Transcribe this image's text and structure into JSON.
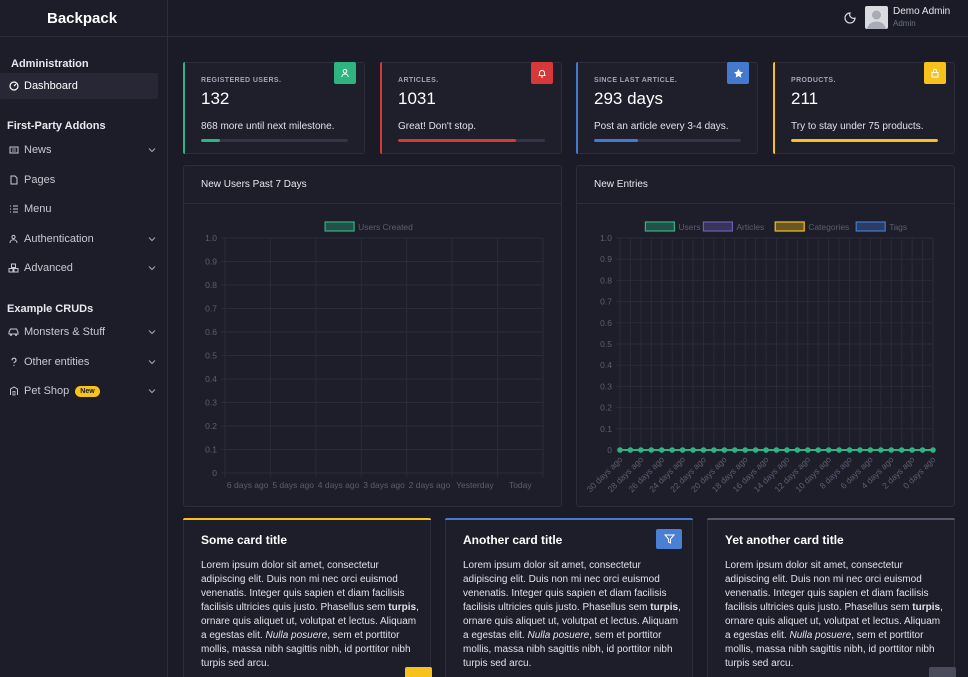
{
  "app": {
    "brand": "Backpack"
  },
  "user": {
    "name": "Demo Admin",
    "role": "Admin"
  },
  "sidebar": {
    "sections": [
      {
        "heading": "Administration",
        "items": [
          {
            "label": "Dashboard",
            "icon": "dashboard-icon",
            "active": true
          }
        ]
      },
      {
        "heading": "First-Party Addons",
        "items": [
          {
            "label": "News",
            "icon": "newspaper-icon",
            "expandable": true
          },
          {
            "label": "Pages",
            "icon": "file-icon"
          },
          {
            "label": "Menu",
            "icon": "list-icon"
          },
          {
            "label": "Authentication",
            "icon": "users-group-icon",
            "expandable": true
          },
          {
            "label": "Advanced",
            "icon": "cubes-icon",
            "expandable": true
          }
        ]
      },
      {
        "heading": "Example CRUDs",
        "items": [
          {
            "label": "Monsters & Stuff",
            "icon": "car-icon",
            "expandable": true
          },
          {
            "label": "Other entities",
            "icon": "question-icon",
            "expandable": true
          },
          {
            "label": "Pet Shop",
            "icon": "paw-icon",
            "expandable": true,
            "badge": "New"
          }
        ]
      }
    ]
  },
  "stats": [
    {
      "label": "REGISTERED USERS.",
      "value": "132",
      "description": "868 more until next milestone.",
      "progress": 0.13,
      "color": "#2fb380",
      "icon": "user-icon"
    },
    {
      "label": "ARTICLES.",
      "value": "1031",
      "description": "Great! Don't stop.",
      "progress": 0.8,
      "color": "#d63939",
      "icon": "bell-icon"
    },
    {
      "label": "SINCE LAST ARTICLE.",
      "value": "293 days",
      "description": "Post an article every 3-4 days.",
      "progress": 0.3,
      "color": "#4479d0",
      "icon": "star-icon"
    },
    {
      "label": "PRODUCTS.",
      "value": "211",
      "description": "Try to stay under 75 products.",
      "progress": 1.0,
      "color": "#f7c21b",
      "icon": "lock-icon"
    }
  ],
  "charts": {
    "users": {
      "title": "New Users Past 7 Days"
    },
    "entries": {
      "title": "New Entries"
    }
  },
  "chart_data": [
    {
      "type": "bar",
      "title": "New Users Past 7 Days",
      "categories": [
        "6 days ago",
        "5 days ago",
        "4 days ago",
        "3 days ago",
        "2 days ago",
        "Yesterday",
        "Today"
      ],
      "series": [
        {
          "name": "Users Created",
          "values": [
            0,
            0,
            0,
            0,
            0,
            0,
            0
          ],
          "color": "#2fb380"
        }
      ],
      "ylim": [
        0,
        1.0
      ],
      "yticks": [
        "0",
        "0.1",
        "0.2",
        "0.3",
        "0.4",
        "0.5",
        "0.6",
        "0.7",
        "0.8",
        "0.9",
        "1.0"
      ],
      "legend": "top",
      "grid": true
    },
    {
      "type": "line",
      "title": "New Entries",
      "categories": [
        "30 days ago",
        "28 days ago",
        "26 days ago",
        "24 days ago",
        "22 days ago",
        "20 days ago",
        "18 days ago",
        "16 days ago",
        "14 days ago",
        "12 days ago",
        "10 days ago",
        "8 days ago",
        "6 days ago",
        "4 days ago",
        "2 days ago",
        "0 days ago"
      ],
      "points": 31,
      "series": [
        {
          "name": "Users",
          "values": [
            0,
            0,
            0,
            0,
            0,
            0,
            0,
            0,
            0,
            0,
            0,
            0,
            0,
            0,
            0,
            0,
            0,
            0,
            0,
            0,
            0,
            0,
            0,
            0,
            0,
            0,
            0,
            0,
            0,
            0,
            0
          ],
          "color": "#2fb380"
        },
        {
          "name": "Articles",
          "values": [
            0,
            0,
            0,
            0,
            0,
            0,
            0,
            0,
            0,
            0,
            0,
            0,
            0,
            0,
            0,
            0,
            0,
            0,
            0,
            0,
            0,
            0,
            0,
            0,
            0,
            0,
            0,
            0,
            0,
            0,
            0
          ],
          "color": "#6a5fb8"
        },
        {
          "name": "Categories",
          "values": [
            0,
            0,
            0,
            0,
            0,
            0,
            0,
            0,
            0,
            0,
            0,
            0,
            0,
            0,
            0,
            0,
            0,
            0,
            0,
            0,
            0,
            0,
            0,
            0,
            0,
            0,
            0,
            0,
            0,
            0,
            0
          ],
          "color": "#f7c21b"
        },
        {
          "name": "Tags",
          "values": [
            0,
            0,
            0,
            0,
            0,
            0,
            0,
            0,
            0,
            0,
            0,
            0,
            0,
            0,
            0,
            0,
            0,
            0,
            0,
            0,
            0,
            0,
            0,
            0,
            0,
            0,
            0,
            0,
            0,
            0,
            0
          ],
          "color": "#4479d0"
        }
      ],
      "ylim": [
        0,
        1.0
      ],
      "yticks": [
        "0",
        "0.1",
        "0.2",
        "0.3",
        "0.4",
        "0.5",
        "0.6",
        "0.7",
        "0.8",
        "0.9",
        "1.0"
      ],
      "legend": "top",
      "grid": true
    }
  ],
  "cards": [
    {
      "title": "Some card title",
      "color": "#f7c21b"
    },
    {
      "title": "Another card title",
      "color": "#4479d0",
      "icon": "filter-icon"
    },
    {
      "title": "Yet another card title",
      "color": "#55586a"
    }
  ],
  "lorem": {
    "a": "Lorem ipsum dolor sit amet, consectetur adipiscing elit. Duis non mi nec orci euismod venenatis. Integer quis sapien et diam facilisis facilisis ultricies quis justo. Phasellus sem ",
    "bold": "turpis",
    "b": ", ornare quis aliquet ut, volutpat et lectus. Aliquam a egestas elit. ",
    "italic": "Nulla posuere",
    "c": ", sem et porttitor mollis, massa nibh sagittis nibh, id porttitor nibh turpis sed arcu."
  }
}
